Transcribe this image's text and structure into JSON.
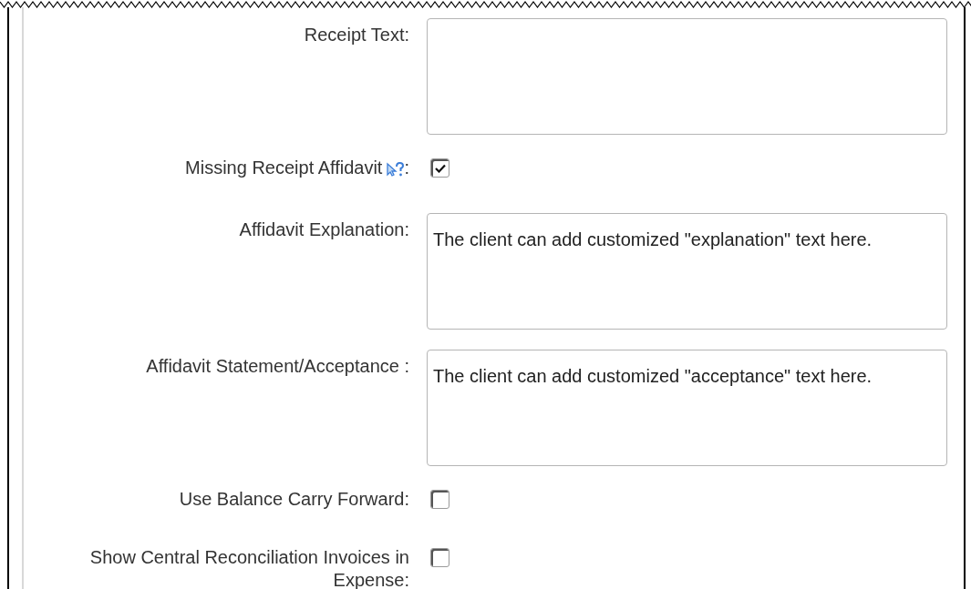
{
  "fields": [
    {
      "kind": "textarea",
      "label": "Receipt Text:"
    },
    {
      "kind": "checkbox",
      "label": "Missing Receipt Affidavit",
      "help": true,
      "suffix": ":",
      "checked": true
    },
    {
      "kind": "textarea",
      "label": "Affidavit Explanation:",
      "value": "The client can add customized \"explanation\" text here."
    },
    {
      "kind": "textarea",
      "label": "Affidavit Statement/Acceptance :",
      "value": "The client can add customized \"acceptance\" text here."
    },
    {
      "kind": "checkbox",
      "label": "Use Balance Carry Forward:",
      "checked": false
    },
    {
      "kind": "checkbox",
      "label": "Show Central Reconciliation Invoices in Expense:",
      "checked": false
    }
  ]
}
